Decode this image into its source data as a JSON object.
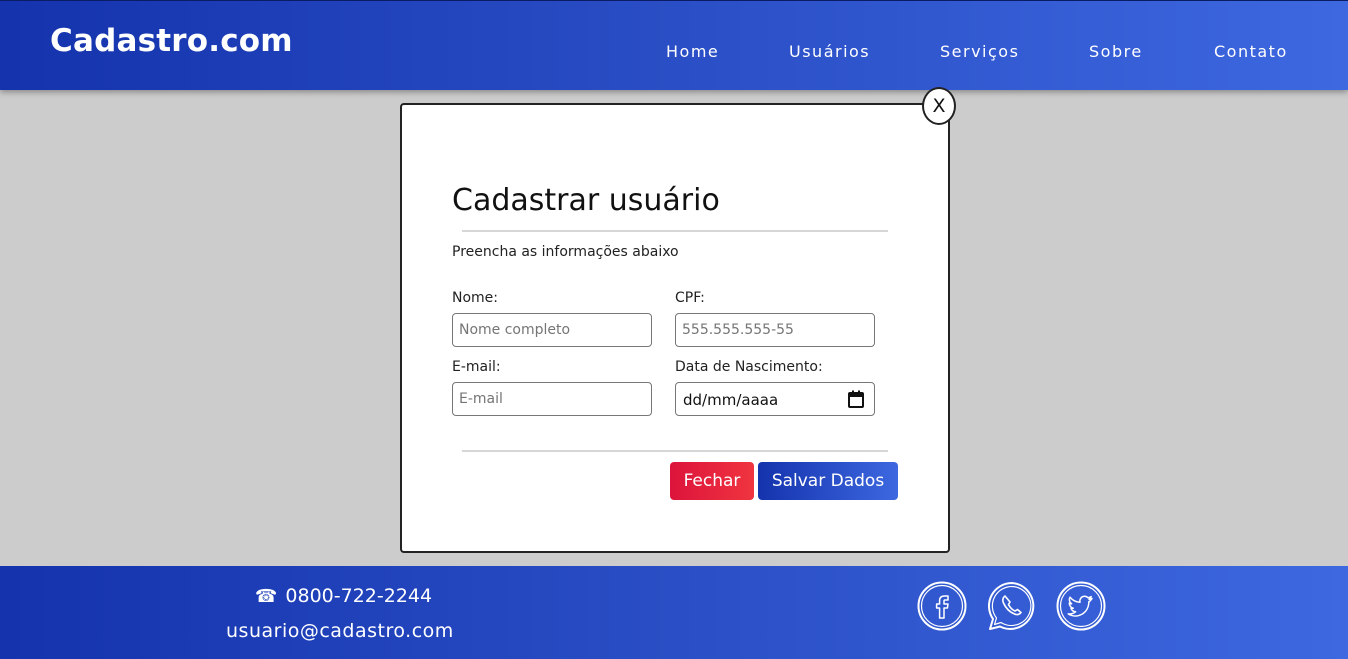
{
  "header": {
    "logo": "Cadastro.com",
    "nav": [
      "Home",
      "Usuários",
      "Serviços",
      "Sobre",
      "Contato"
    ]
  },
  "modal": {
    "close_label": "X",
    "title": "Cadastrar usuário",
    "subtitle": "Preencha as informações abaixo",
    "fields": {
      "nome": {
        "label": "Nome:",
        "placeholder": "Nome completo",
        "value": ""
      },
      "cpf": {
        "label": "CPF:",
        "placeholder": "555.555.555-55",
        "value": ""
      },
      "email": {
        "label": "E-mail:",
        "placeholder": "E-mail",
        "value": ""
      },
      "nascimento": {
        "label": "Data de Nascimento:",
        "display": "dd/mm/aaaa",
        "icon": "calendar-icon"
      }
    },
    "buttons": {
      "close": "Fechar",
      "save": "Salvar Dados"
    }
  },
  "footer": {
    "phone_icon": "phone-icon",
    "phone": "0800-722-2244",
    "email": "usuario@cadastro.com",
    "social": [
      "facebook-icon",
      "whatsapp-icon",
      "twitter-icon"
    ]
  },
  "colors": {
    "brand_gradient_start": "#1433ad",
    "brand_gradient_end": "#3d68e0",
    "danger": "#dc143c",
    "overlay": "#cccccc"
  }
}
